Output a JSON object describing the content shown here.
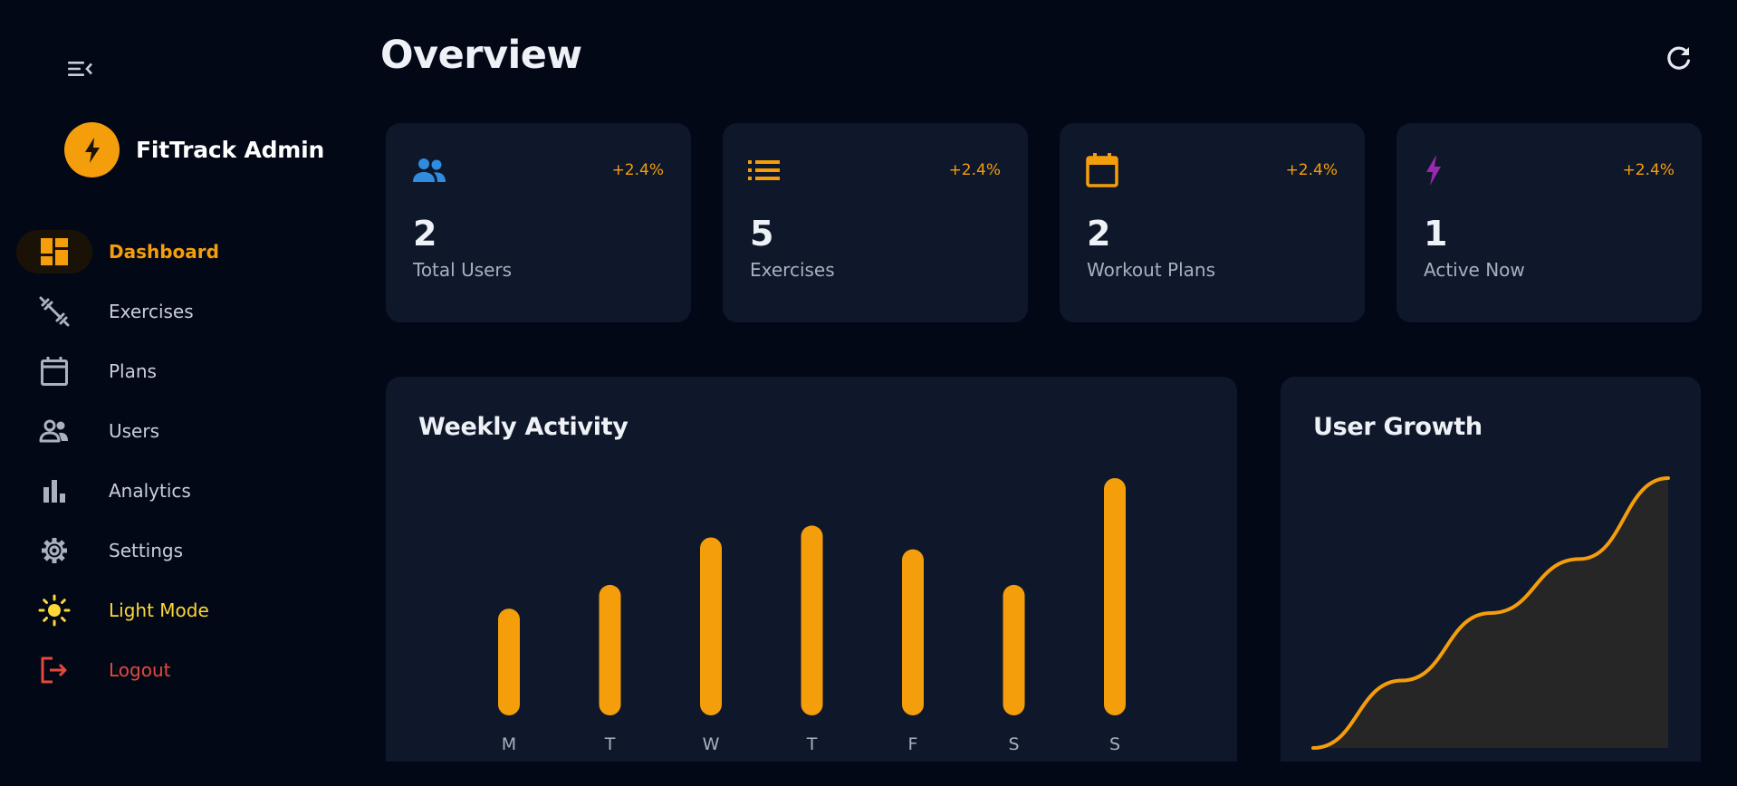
{
  "sidebar": {
    "brand_name": "FitTrack Admin",
    "items": [
      {
        "label": "Dashboard",
        "icon": "dashboard-icon",
        "active": true
      },
      {
        "label": "Exercises",
        "icon": "dumbbell-icon"
      },
      {
        "label": "Plans",
        "icon": "calendar-icon"
      },
      {
        "label": "Users",
        "icon": "users-icon"
      },
      {
        "label": "Analytics",
        "icon": "bar-chart-icon"
      },
      {
        "label": "Settings",
        "icon": "gear-icon"
      },
      {
        "label": "Light Mode",
        "icon": "sun-icon"
      },
      {
        "label": "Logout",
        "icon": "logout-icon"
      }
    ]
  },
  "header": {
    "title": "Overview"
  },
  "stats": [
    {
      "value": "2",
      "label": "Total Users",
      "change": "+2.4%",
      "icon": "users-icon",
      "icon_color": "#2f8ce0"
    },
    {
      "value": "5",
      "label": "Exercises",
      "change": "+2.4%",
      "icon": "list-icon",
      "icon_color": "#f59e0b"
    },
    {
      "value": "2",
      "label": "Workout Plans",
      "change": "+2.4%",
      "icon": "calendar-icon",
      "icon_color": "#f59e0b"
    },
    {
      "value": "1",
      "label": "Active Now",
      "change": "+2.4%",
      "icon": "lightning-icon",
      "icon_color": "#9c27b0"
    }
  ],
  "colors": {
    "accent": "#f59e0b",
    "background": "#030817",
    "card": "#0f172a",
    "theme_toggle": "#fbd738",
    "logout": "#e34a3c"
  },
  "weekly_activity": {
    "title": "Weekly Activity"
  },
  "user_growth": {
    "title": "User Growth"
  },
  "chart_data": [
    {
      "type": "bar",
      "title": "Weekly Activity",
      "categories": [
        "M",
        "T",
        "W",
        "T",
        "F",
        "S",
        "S"
      ],
      "values": [
        45,
        55,
        75,
        80,
        70,
        55,
        100
      ],
      "ylim": [
        0,
        100
      ],
      "grid": false,
      "color": "#f59e0b"
    },
    {
      "type": "area",
      "title": "User Growth",
      "x": [
        0,
        1,
        2,
        3,
        4
      ],
      "values": [
        0,
        25,
        50,
        70,
        100
      ],
      "ylim": [
        0,
        100
      ],
      "grid": false,
      "color": "#f59e0b"
    }
  ]
}
